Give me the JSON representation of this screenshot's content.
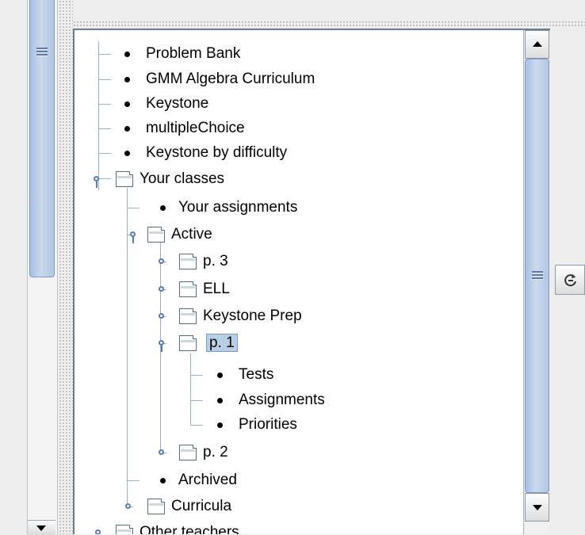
{
  "tree": {
    "items": [
      {
        "label": "Problem Bank",
        "type": "leaf"
      },
      {
        "label": "GMM Algebra Curriculum",
        "type": "leaf"
      },
      {
        "label": "Keystone",
        "type": "leaf"
      },
      {
        "label": "multipleChoice",
        "type": "leaf"
      },
      {
        "label": "Keystone by difficulty",
        "type": "leaf"
      },
      {
        "label": "Your classes",
        "type": "folder",
        "expanded": true
      },
      {
        "label": "Your assignments",
        "type": "leaf"
      },
      {
        "label": "Active",
        "type": "folder",
        "expanded": true
      },
      {
        "label": "p. 3",
        "type": "folder",
        "expanded": false
      },
      {
        "label": "ELL",
        "type": "folder",
        "expanded": false
      },
      {
        "label": "Keystone Prep",
        "type": "folder",
        "expanded": false
      },
      {
        "label": "p. 1",
        "type": "folder",
        "expanded": true,
        "selected": true
      },
      {
        "label": "Tests",
        "type": "leaf"
      },
      {
        "label": "Assignments",
        "type": "leaf"
      },
      {
        "label": "Priorities",
        "type": "leaf"
      },
      {
        "label": "p. 2",
        "type": "folder",
        "expanded": false
      },
      {
        "label": "Archived",
        "type": "leaf"
      },
      {
        "label": "Curricula",
        "type": "folder",
        "expanded": false
      },
      {
        "label": "Other teachers",
        "type": "folder",
        "expanded": false
      }
    ]
  },
  "icons": {
    "refresh": "refresh-icon",
    "scroll_up": "arrow-up-icon",
    "scroll_down": "arrow-down-icon"
  },
  "colors": {
    "selection": "#b8cfe5",
    "scroll_thumb": "#b3c7e3",
    "tree_line": "#9aaed0"
  }
}
